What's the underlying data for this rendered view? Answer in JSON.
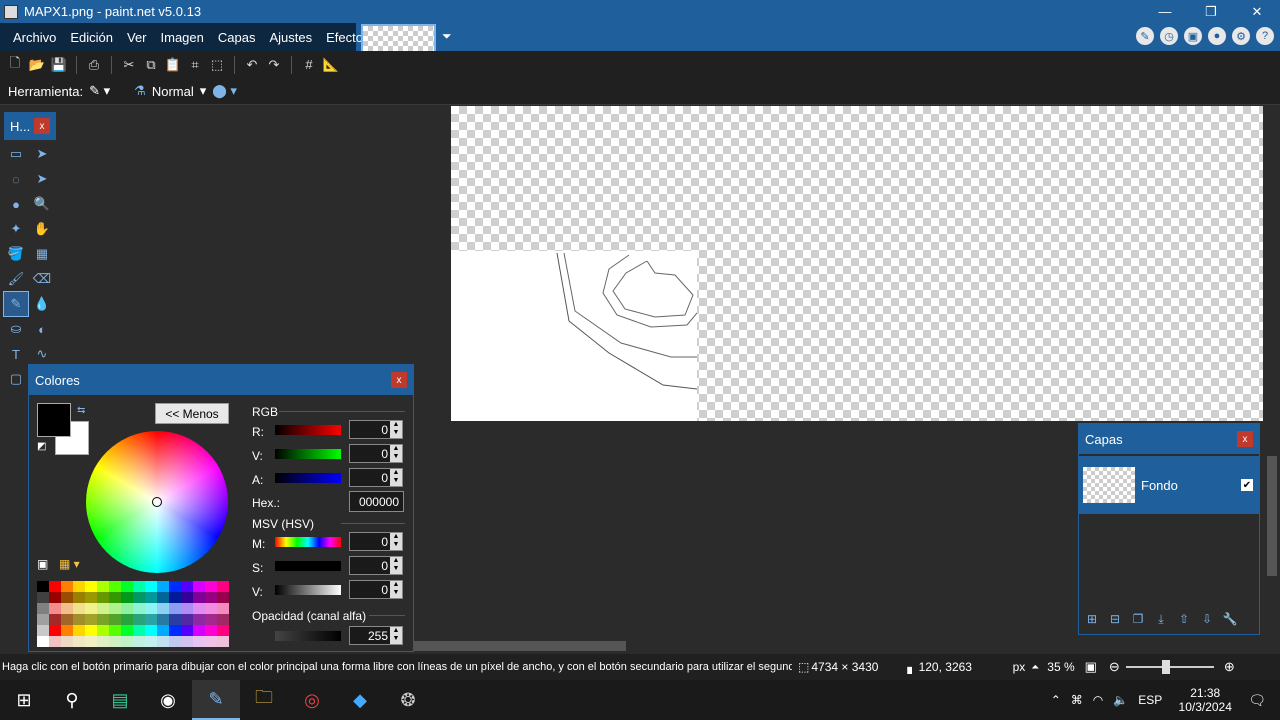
{
  "window": {
    "title": "MAPX1.png - paint.net v5.0.13",
    "minimize": "—",
    "maximize": "❐",
    "close": "✕"
  },
  "menu": [
    "Archivo",
    "Edición",
    "Ver",
    "Imagen",
    "Capas",
    "Ajustes",
    "Efectos"
  ],
  "toolbar2": {
    "tool_label": "Herramienta:",
    "blend_mode": "Normal"
  },
  "tools_panel": {
    "title": "H...",
    "close": "x"
  },
  "colors_panel": {
    "title": "Colores",
    "close": "x",
    "less_button": "<< Menos",
    "rgb_label": "RGB",
    "r_label": "R:",
    "g_label": "V:",
    "b_label": "A:",
    "r": "0",
    "g": "0",
    "b": "0",
    "hex_label": "Hex.:",
    "hex": "000000",
    "hsv_label": "MSV (HSV)",
    "h_label": "M:",
    "s_label": "S:",
    "v_label": "V:",
    "h": "0",
    "s": "0",
    "v": "0",
    "alpha_label": "Opacidad (canal alfa)",
    "alpha": "255"
  },
  "layers_panel": {
    "title": "Capas",
    "close": "x",
    "layer_name": "Fondo"
  },
  "status": {
    "hint": "Haga clic con el botón primario para dibujar con el color principal una forma libre con líneas de un píxel de ancho, y con el botón secundario para utilizar el segundo color.",
    "image_size": "4734 × 3430",
    "cursor": "120, 3263",
    "unit": "px",
    "zoom": "35 %"
  },
  "taskbar": {
    "lang": "ESP",
    "time": "21:38",
    "date": "10/3/2024"
  },
  "accent": "#1f5f9c"
}
